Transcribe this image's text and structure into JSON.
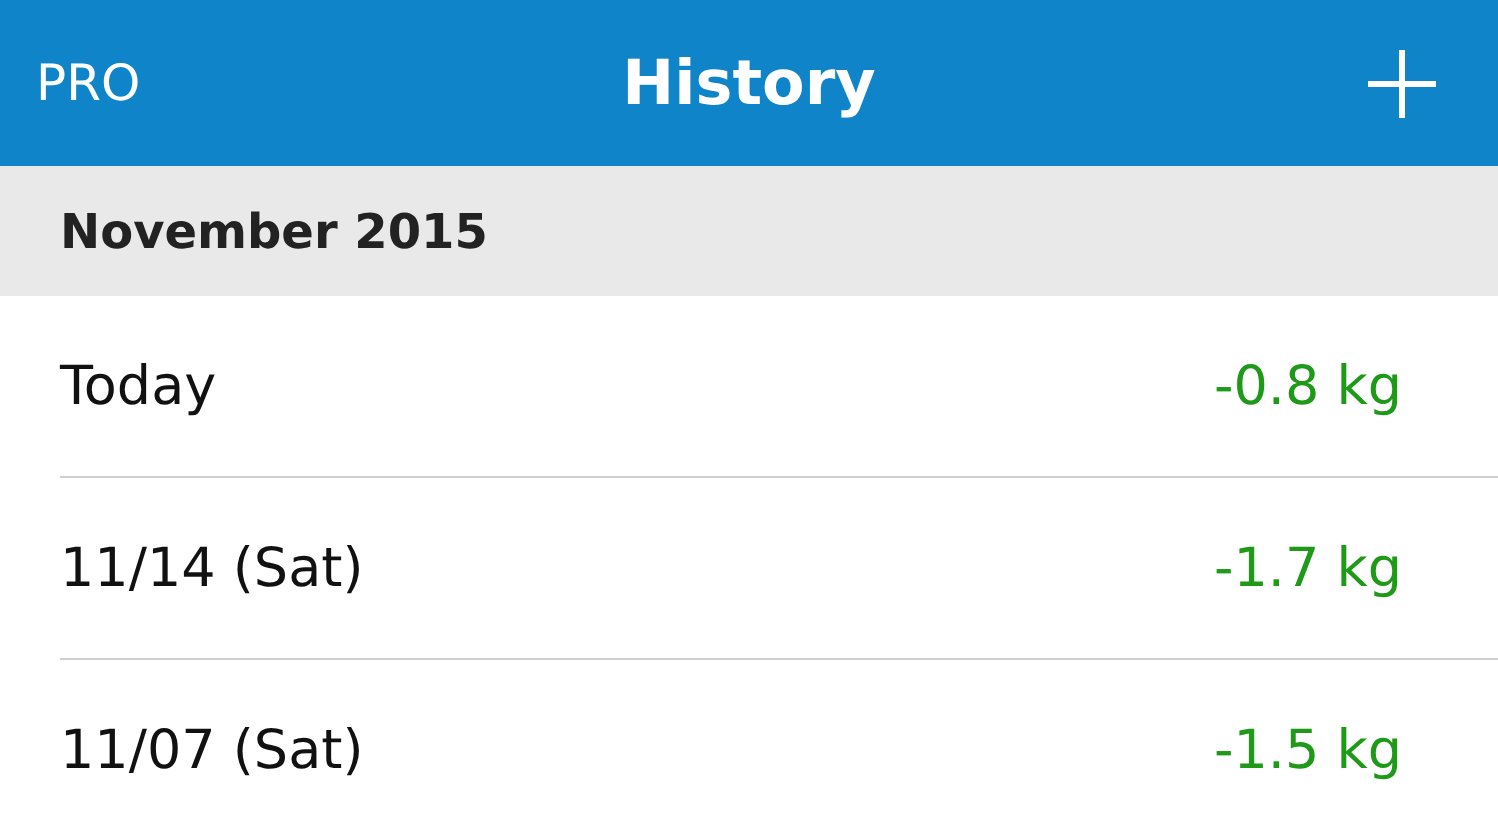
{
  "nav_bar": {
    "left_button": "PRO",
    "title": "History"
  },
  "sections": [
    {
      "header": "November 2015",
      "rows": [
        {
          "date": "Today",
          "change": "-0.8 kg"
        },
        {
          "date": "11/14 (Sat)",
          "change": "-1.7 kg"
        },
        {
          "date": "11/07 (Sat)",
          "change": "-1.5 kg"
        }
      ]
    }
  ]
}
